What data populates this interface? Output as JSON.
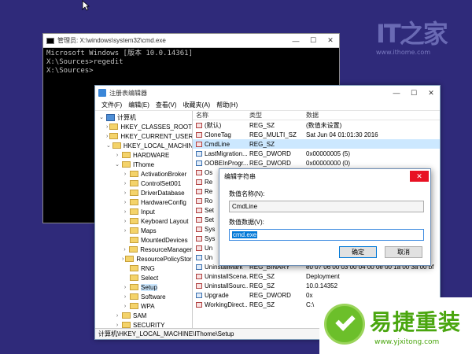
{
  "watermark": {
    "logo": "IT之家",
    "url": "www.ithome.com"
  },
  "cmd": {
    "title": "管理员: X:\\windows\\system32\\cmd.exe",
    "lines": [
      "Microsoft Windows [版本 10.0.14361]",
      "",
      "X:\\Sources>regedit",
      "",
      "X:\\Sources>"
    ]
  },
  "regedit": {
    "title": "注册表编辑器",
    "menu": [
      "文件(F)",
      "编辑(E)",
      "查看(V)",
      "收藏夹(A)",
      "帮助(H)"
    ],
    "tree": [
      {
        "label": "计算机",
        "level": 0,
        "expander": "⌄",
        "icon": "computer-icon"
      },
      {
        "label": "HKEY_CLASSES_ROOT",
        "level": 1,
        "expander": "›",
        "icon": "folder-icon"
      },
      {
        "label": "HKEY_CURRENT_USER",
        "level": 1,
        "expander": "›",
        "icon": "folder-icon"
      },
      {
        "label": "HKEY_LOCAL_MACHINE",
        "level": 1,
        "expander": "⌄",
        "icon": "folder-icon"
      },
      {
        "label": "HARDWARE",
        "level": 2,
        "expander": "›",
        "icon": "folder-icon"
      },
      {
        "label": "IThome",
        "level": 2,
        "expander": "⌄",
        "icon": "folder-icon"
      },
      {
        "label": "ActivationBroker",
        "level": 3,
        "expander": "›",
        "icon": "folder-icon"
      },
      {
        "label": "ControlSet001",
        "level": 3,
        "expander": "›",
        "icon": "folder-icon"
      },
      {
        "label": "DriverDatabase",
        "level": 3,
        "expander": "›",
        "icon": "folder-icon"
      },
      {
        "label": "HardwareConfig",
        "level": 3,
        "expander": "›",
        "icon": "folder-icon"
      },
      {
        "label": "Input",
        "level": 3,
        "expander": "›",
        "icon": "folder-icon"
      },
      {
        "label": "Keyboard Layout",
        "level": 3,
        "expander": "›",
        "icon": "folder-icon"
      },
      {
        "label": "Maps",
        "level": 3,
        "expander": "›",
        "icon": "folder-icon"
      },
      {
        "label": "MountedDevices",
        "level": 3,
        "expander": "",
        "icon": "folder-icon"
      },
      {
        "label": "ResourceManager",
        "level": 3,
        "expander": "›",
        "icon": "folder-icon"
      },
      {
        "label": "ResourcePolicyStore",
        "level": 3,
        "expander": "›",
        "icon": "folder-icon"
      },
      {
        "label": "RNG",
        "level": 3,
        "expander": "",
        "icon": "folder-icon"
      },
      {
        "label": "Select",
        "level": 3,
        "expander": "",
        "icon": "folder-icon"
      },
      {
        "label": "Setup",
        "level": 3,
        "expander": "›",
        "icon": "folder-icon",
        "selected": true
      },
      {
        "label": "Software",
        "level": 3,
        "expander": "›",
        "icon": "folder-icon"
      },
      {
        "label": "WPA",
        "level": 3,
        "expander": "›",
        "icon": "folder-icon"
      },
      {
        "label": "SAM",
        "level": 2,
        "expander": "›",
        "icon": "folder-icon"
      },
      {
        "label": "SECURITY",
        "level": 2,
        "expander": "›",
        "icon": "folder-icon"
      }
    ],
    "columns": {
      "name": "名称",
      "type": "类型",
      "data": "数据"
    },
    "values": [
      {
        "name": "(默认)",
        "type": "REG_SZ",
        "data": "(数值未设置)",
        "icon": "ab"
      },
      {
        "name": "CloneTag",
        "type": "REG_MULTI_SZ",
        "data": "Sat Jun 04 01:01:30 2016",
        "icon": "ab"
      },
      {
        "name": "CmdLine",
        "type": "REG_SZ",
        "data": "",
        "icon": "ab",
        "selected": true
      },
      {
        "name": "LastMigration...",
        "type": "REG_DWORD",
        "data": "0x00000005 (5)",
        "icon": "bin"
      },
      {
        "name": "OOBEInProgr...",
        "type": "REG_DWORD",
        "data": "0x00000000 (0)",
        "icon": "bin"
      },
      {
        "name": "Os",
        "type": "",
        "data": "",
        "icon": "ab"
      },
      {
        "name": "Re",
        "type": "",
        "data": "",
        "icon": "ab"
      },
      {
        "name": "Re",
        "type": "",
        "data": "",
        "icon": "ab"
      },
      {
        "name": "Ro",
        "type": "",
        "data": "",
        "icon": "ab"
      },
      {
        "name": "Set",
        "type": "",
        "data": "",
        "icon": "ab"
      },
      {
        "name": "Set",
        "type": "",
        "data": "",
        "icon": "ab"
      },
      {
        "name": "Sys",
        "type": "",
        "data": "",
        "icon": "ab"
      },
      {
        "name": "Sys",
        "type": "",
        "data": "",
        "icon": "ab"
      },
      {
        "name": "Un",
        "type": "",
        "data": "",
        "icon": "ab"
      },
      {
        "name": "Un",
        "type": "",
        "data": "1)",
        "icon": "bin"
      },
      {
        "name": "UninstallMark",
        "type": "REG_BINARY",
        "data": "e0 07 06 00 03 00 04 00 0e 00 1a 00 3a 00 bf",
        "icon": "bin"
      },
      {
        "name": "UninstallScena...",
        "type": "REG_SZ",
        "data": "Deployment",
        "icon": "ab"
      },
      {
        "name": "UninstallSourc...",
        "type": "REG_SZ",
        "data": "10.0.14352",
        "icon": "ab"
      },
      {
        "name": "Upgrade",
        "type": "REG_DWORD",
        "data": "0x",
        "icon": "bin"
      },
      {
        "name": "WorkingDirect...",
        "type": "REG_SZ",
        "data": "C:\\",
        "icon": "ab"
      }
    ],
    "status": "计算机\\HKEY_LOCAL_MACHINE\\IThome\\Setup"
  },
  "dialog": {
    "title": "编辑字符串",
    "name_label": "数值名称(N):",
    "name_value": "CmdLine",
    "data_label": "数值数据(V):",
    "data_value": "cmd.exe",
    "ok": "确定",
    "cancel": "取消"
  },
  "banner": {
    "brand": "易捷重装",
    "site": "www.yjxitong.com"
  }
}
